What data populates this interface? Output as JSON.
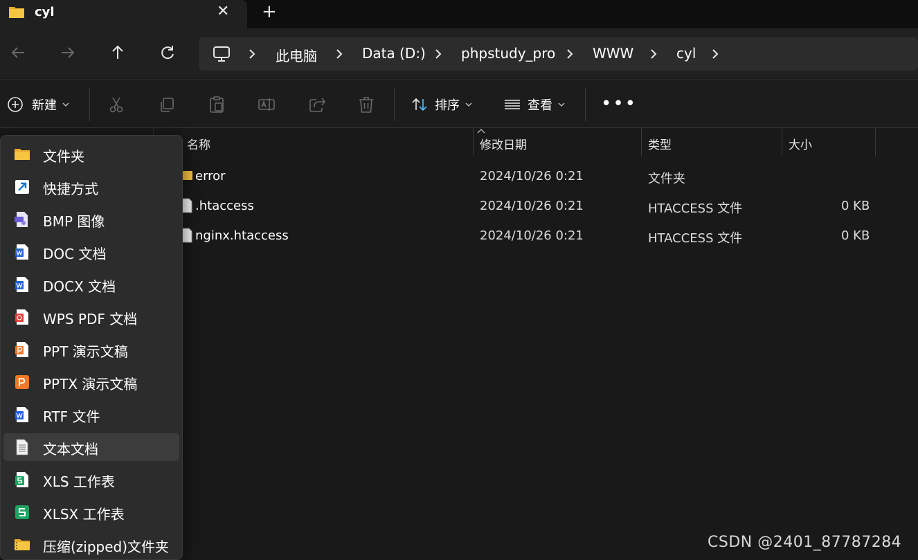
{
  "tab": {
    "title": "cyl",
    "close_glyph": "✕",
    "new_tab_glyph": "+"
  },
  "breadcrumb": [
    "此电脑",
    "Data (D:)",
    "phpstudy_pro",
    "WWW",
    "cyl"
  ],
  "toolbar": {
    "new_label": "新建",
    "sort_label": "排序",
    "view_label": "查看",
    "more_label": "•••"
  },
  "columns": {
    "name": "名称",
    "modified": "修改日期",
    "type": "类型",
    "size": "大小"
  },
  "files": [
    {
      "name": "error",
      "modified": "2024/10/26 0:21",
      "type": "文件夹",
      "size": "",
      "icon": "folder-icon"
    },
    {
      "name": ".htaccess",
      "modified": "2024/10/26 0:21",
      "type": "HTACCESS 文件",
      "size": "0 KB",
      "icon": "file-icon"
    },
    {
      "name": "nginx.htaccess",
      "modified": "2024/10/26 0:21",
      "type": "HTACCESS 文件",
      "size": "0 KB",
      "icon": "file-icon"
    }
  ],
  "new_menu": {
    "items": [
      {
        "label": "文件夹",
        "icon": "folder-icon"
      },
      {
        "label": "快捷方式",
        "icon": "shortcut-icon"
      },
      {
        "label": "BMP 图像",
        "icon": "bmp-image-icon"
      },
      {
        "label": "DOC 文档",
        "icon": "word-doc-icon"
      },
      {
        "label": "DOCX 文档",
        "icon": "word-docx-icon"
      },
      {
        "label": "WPS PDF 文档",
        "icon": "pdf-icon"
      },
      {
        "label": "PPT 演示文稿",
        "icon": "ppt-icon"
      },
      {
        "label": "PPTX 演示文稿",
        "icon": "pptx-icon"
      },
      {
        "label": "RTF 文件",
        "icon": "rtf-icon"
      },
      {
        "label": "文本文档",
        "icon": "text-document-icon"
      },
      {
        "label": "XLS 工作表",
        "icon": "xls-icon"
      },
      {
        "label": "XLSX 工作表",
        "icon": "xlsx-icon"
      },
      {
        "label": "压缩(zipped)文件夹",
        "icon": "zip-folder-icon"
      }
    ],
    "highlighted": "文本文档"
  },
  "watermark": "CSDN @2401_87787284",
  "colors": {
    "accent": "#4cc2ff",
    "folder": "#f4c042",
    "background": "#191919",
    "menu": "#2c2c2c"
  }
}
